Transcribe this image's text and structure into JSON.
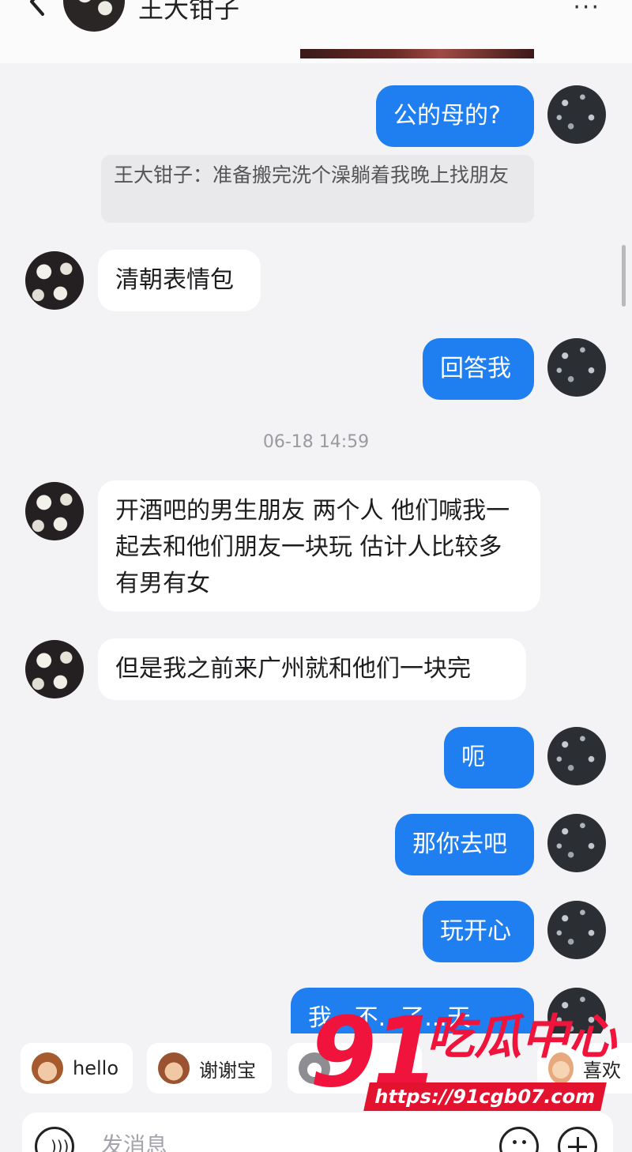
{
  "header": {
    "title": "王大钳子",
    "more_label": "···"
  },
  "quote": {
    "text": "王大钳子：准备搬完洗个澡躺着我晚上找朋友"
  },
  "messages": [
    {
      "side": "out",
      "text": "公的母的?"
    },
    {
      "side": "in",
      "text": "清朝表情包"
    },
    {
      "side": "out",
      "text": "回答我"
    },
    {
      "side": "in",
      "text": "开酒吧的男生朋友 两个人 他们喊我一起去和他们朋友一块玩 估计人比较多 有男有女"
    },
    {
      "side": "in",
      "text": "但是我之前来广州就和他们一块完"
    },
    {
      "side": "out",
      "text": "呃"
    },
    {
      "side": "out",
      "text": "那你去吧"
    },
    {
      "side": "out",
      "text": "玩开心"
    },
    {
      "side": "out",
      "text": "我...不...了...天"
    }
  ],
  "timestamp": "06-18 14:59",
  "quick_replies": [
    {
      "emoji": "monkey",
      "label": "hello"
    },
    {
      "emoji": "monkey",
      "label": "谢谢宝"
    },
    {
      "emoji": "cat",
      "label": ""
    },
    {
      "emoji": "face",
      "label": "喜欢"
    }
  ],
  "composer": {
    "placeholder": "发消息"
  },
  "watermark": {
    "number": "91",
    "name": "吃瓜中心",
    "url": "https://91cgb07.com"
  }
}
